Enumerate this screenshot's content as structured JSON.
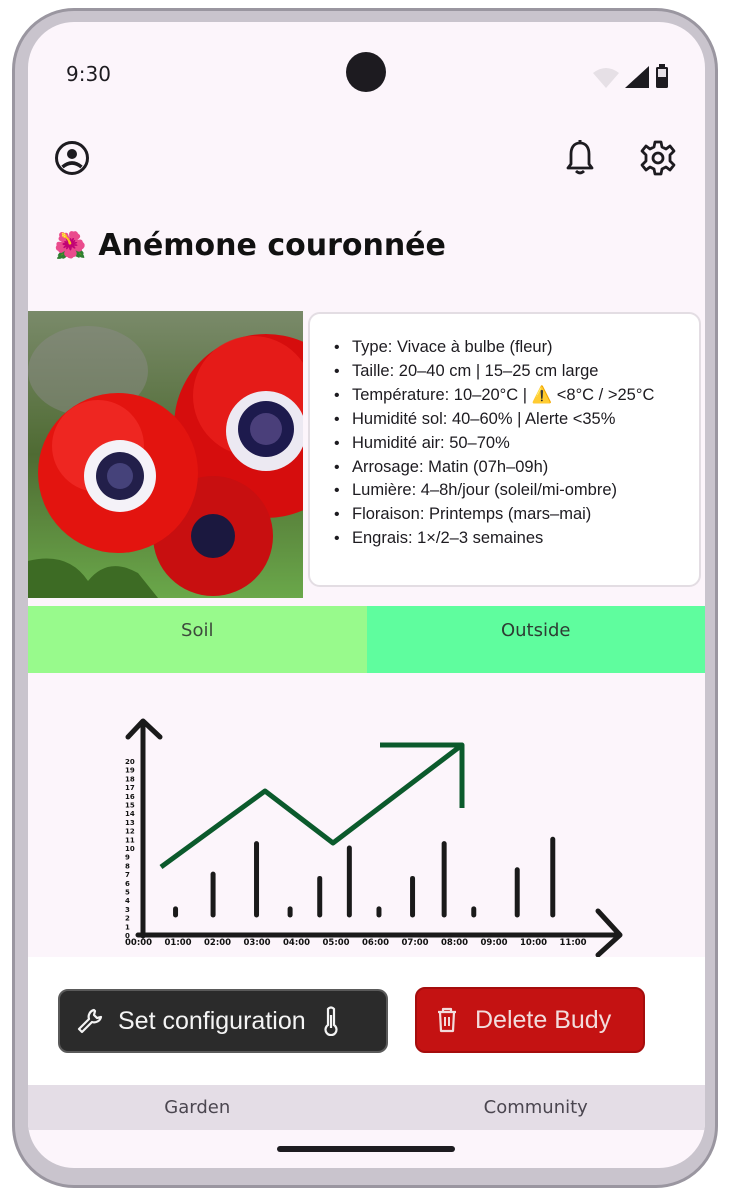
{
  "status_bar": {
    "time": "9:30"
  },
  "icons": {
    "account": "account-circle-icon",
    "notifications": "bell-icon",
    "settings": "gear-icon",
    "plant": "hibiscus-icon",
    "wrench": "wrench-icon",
    "thermometer": "thermometer-icon",
    "trash": "trash-icon"
  },
  "plant": {
    "emoji": "🌺",
    "name": "Anémone couronnée",
    "details": [
      "Type: Vivace à bulbe (fleur)",
      "Taille: 20–40 cm | 15–25 cm large",
      "Température: 10–20°C | ⚠️ <8°C / >25°C",
      "Humidité sol: 40–60% | Alerte <35%",
      "Humidité air: 50–70%",
      "Arrosage: Matin (07h–09h)",
      "Lumière: 4–8h/jour (soleil/mi-ombre)",
      "Floraison: Printemps (mars–mai)",
      "Engrais: 1×/2–3 semaines"
    ]
  },
  "tabs": [
    {
      "label": "Soil",
      "color": "#98fa8c"
    },
    {
      "label": "Outside",
      "color": "#5ffd9e"
    }
  ],
  "chart_data": {
    "type": "bar",
    "categories": [
      "00:00",
      "01:00",
      "02:00",
      "03:00",
      "04:00",
      "05:00",
      "06:00",
      "07:00",
      "08:00",
      "09:00",
      "10:00",
      "11:00"
    ],
    "y_ticks": [
      0,
      1,
      2,
      3,
      4,
      5,
      6,
      7,
      8,
      9,
      10,
      11,
      12,
      13,
      14,
      15,
      16,
      17,
      18,
      19,
      20
    ],
    "ylim": [
      0,
      20
    ],
    "bar_x": [
      0.9,
      1.85,
      2.95,
      3.8,
      4.55,
      5.3,
      6.05,
      6.9,
      7.7,
      8.45,
      9.55,
      10.45
    ],
    "values": [
      3,
      7,
      10.5,
      3,
      6.5,
      10,
      3,
      6.5,
      10.5,
      3,
      7.5,
      11
    ],
    "title": "",
    "xlabel": "",
    "ylabel": "",
    "trend_color": "#0b5a2c",
    "bar_color": "#1a1a1a"
  },
  "actions": {
    "set_configuration": "Set configuration",
    "delete": "Delete Budy"
  },
  "bottom_nav": [
    {
      "label": "Garden"
    },
    {
      "label": "Community"
    }
  ]
}
